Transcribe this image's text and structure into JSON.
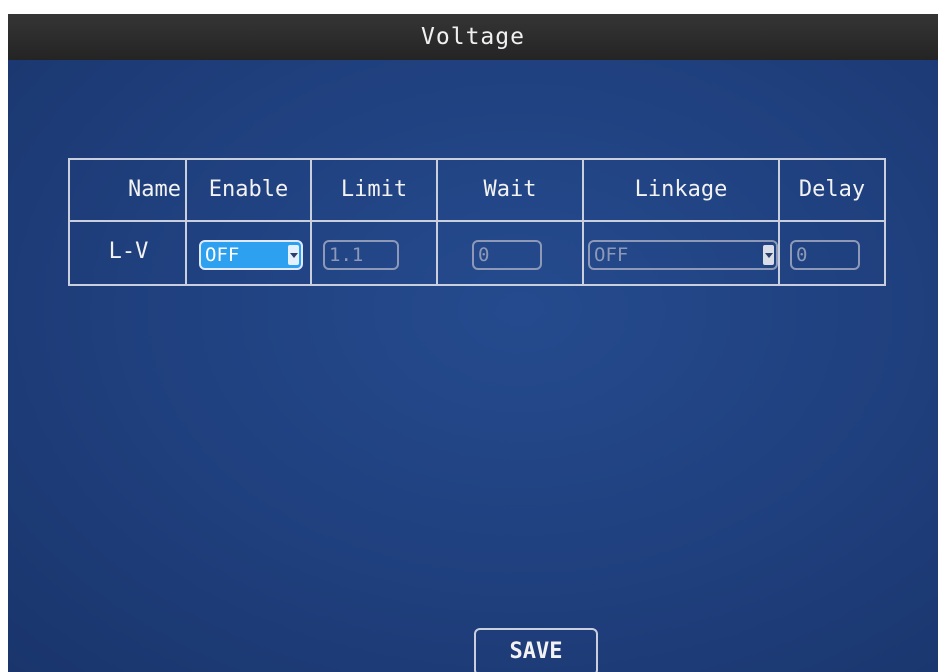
{
  "window": {
    "title": "Voltage"
  },
  "table": {
    "headers": {
      "name": "Name",
      "enable": "Enable",
      "limit": "Limit",
      "wait": "Wait",
      "linkage": "Linkage",
      "delay": "Delay"
    },
    "rows": [
      {
        "name": "L-V",
        "enable": "OFF",
        "limit": "1.1",
        "wait": "0",
        "linkage": "OFF",
        "delay": "0"
      }
    ]
  },
  "actions": {
    "save_label": "SAVE"
  },
  "icons": {
    "dropdown": "chevron-down-icon"
  },
  "colors": {
    "background": "#1f3f7d",
    "titlebar": "#2c2c2c",
    "selected_field": "#2ea0f0",
    "grid_lines": "#c9cfdc",
    "inactive_field": "#8d99b6"
  }
}
